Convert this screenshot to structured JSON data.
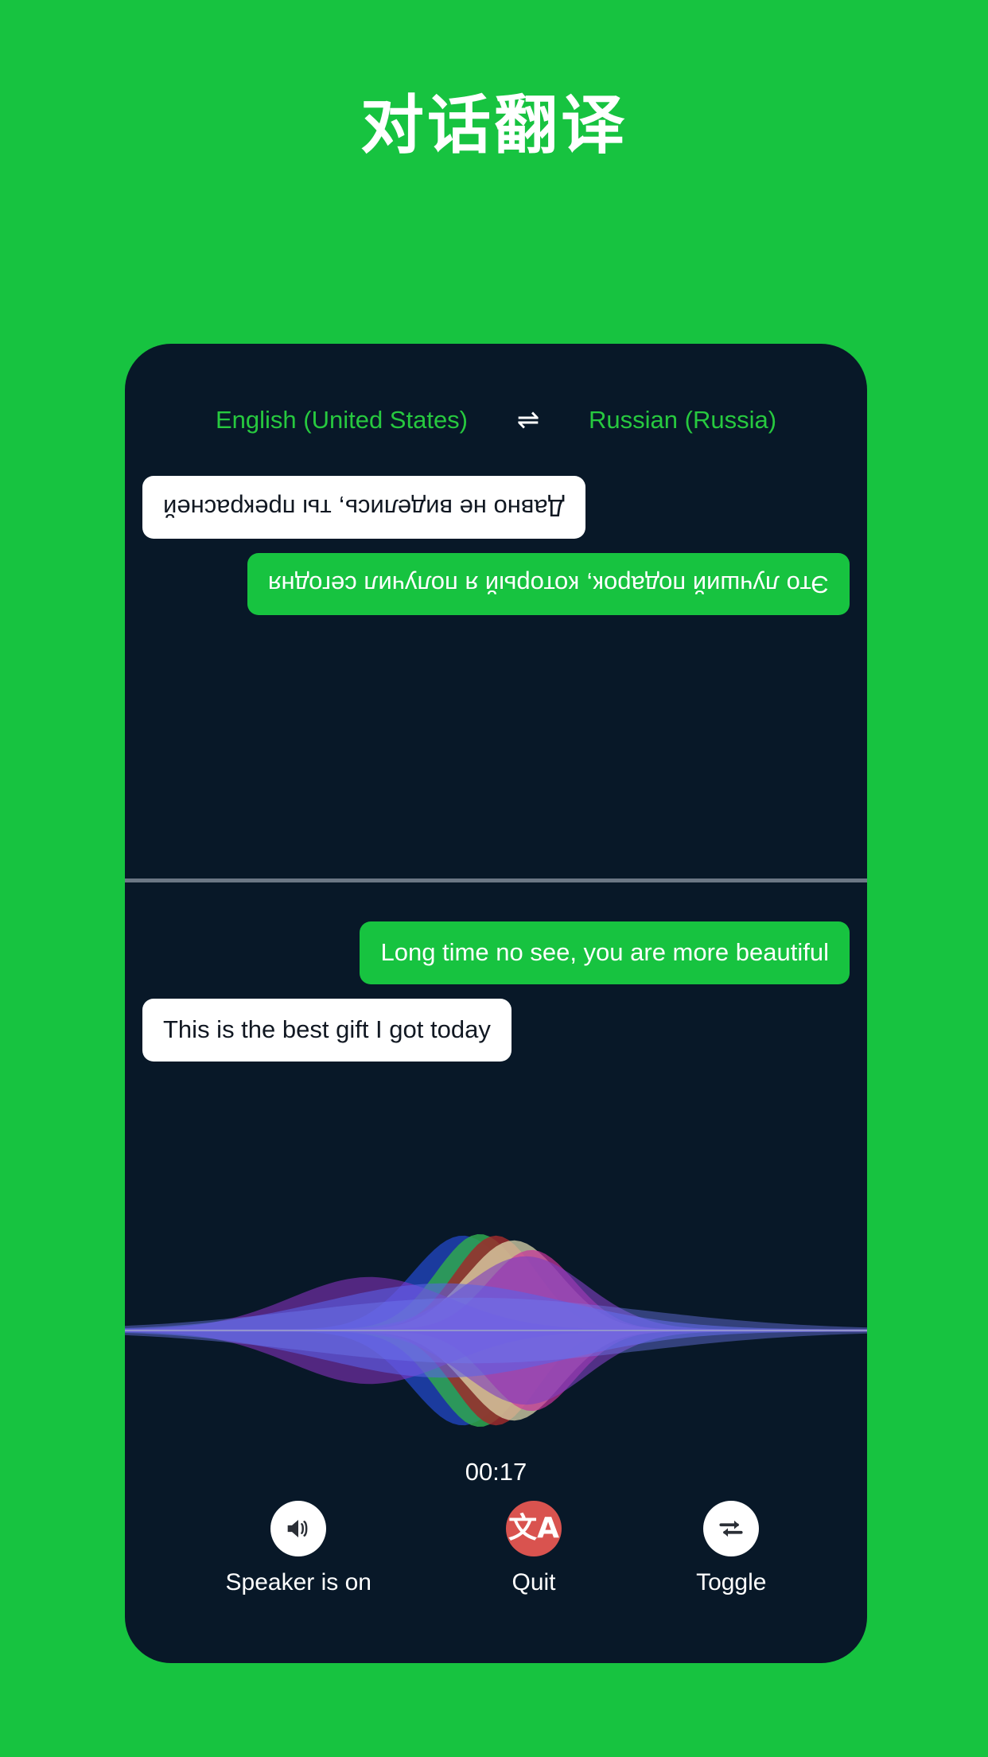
{
  "page": {
    "title": "对话翻译",
    "background_color": "#17c340",
    "device_background_color": "#081828"
  },
  "language_bar": {
    "source_language": "English (United States)",
    "swap_icon": "swap-arrows-icon",
    "swap_glyph": "⇌",
    "target_language": "Russian (Russia)",
    "text_color": "#27c93f"
  },
  "conversation": {
    "remote_pane": {
      "rotated": true,
      "messages": [
        {
          "align": "left",
          "style": "green",
          "text": "Это лучший подарок, который я получил сегодня"
        },
        {
          "align": "right",
          "style": "white",
          "text": "Давно не виделись, ты прекрасней"
        }
      ]
    },
    "local_pane": {
      "rotated": false,
      "messages": [
        {
          "align": "right",
          "style": "green",
          "text": "Long time no see, you are more beautiful"
        },
        {
          "align": "left",
          "style": "white",
          "text": "This is the best gift I got today"
        }
      ]
    }
  },
  "waveform": {
    "name": "audio-waveform-visualizer",
    "bands": [
      {
        "color": "#1d3fa8",
        "opacity": 0.92,
        "center": 0.455,
        "width": 0.095,
        "amplitude": 118
      },
      {
        "color": "#2fa84f",
        "opacity": 0.85,
        "center": 0.478,
        "width": 0.082,
        "amplitude": 120
      },
      {
        "color": "#9c2b2b",
        "opacity": 0.85,
        "center": 0.5,
        "width": 0.078,
        "amplitude": 118
      },
      {
        "color": "#e2dcb0",
        "opacity": 0.72,
        "center": 0.524,
        "width": 0.09,
        "amplitude": 112
      },
      {
        "color": "#c9339b",
        "opacity": 0.7,
        "center": 0.548,
        "width": 0.082,
        "amplitude": 100
      },
      {
        "color": "#7e3fc0",
        "opacity": 0.62,
        "center": 0.54,
        "width": 0.115,
        "amplitude": 92
      },
      {
        "color": "#8f35c9",
        "opacity": 0.55,
        "center": 0.33,
        "width": 0.15,
        "amplitude": 66
      },
      {
        "color": "#5c63e8",
        "opacity": 0.58,
        "center": 0.43,
        "width": 0.23,
        "amplitude": 58
      },
      {
        "color": "#6f7bf0",
        "opacity": 0.42,
        "center": 0.47,
        "width": 0.32,
        "amplitude": 40
      }
    ],
    "baseline_color": "#aab4c0"
  },
  "timer": {
    "label": "00:17"
  },
  "controls": [
    {
      "id": "speaker",
      "icon": "speaker-on-icon",
      "label": "Speaker is on",
      "circle_style": "light",
      "circle_color": "#ffffff"
    },
    {
      "id": "quit",
      "icon": "translate-icon",
      "label": "Quit",
      "circle_style": "danger",
      "circle_color": "#d9534f"
    },
    {
      "id": "toggle",
      "icon": "repeat-toggle-icon",
      "label": "Toggle",
      "circle_style": "light",
      "circle_color": "#ffffff"
    }
  ]
}
